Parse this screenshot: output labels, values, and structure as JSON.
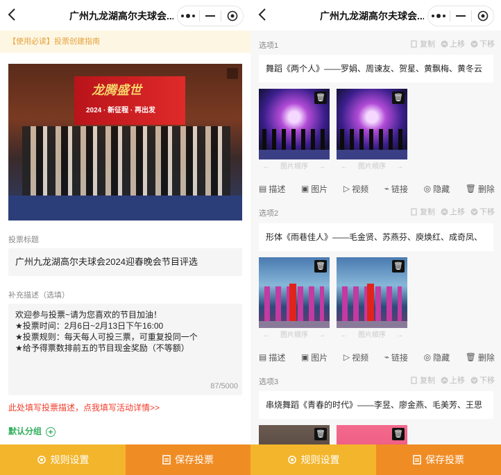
{
  "header": {
    "title": "广州九龙湖高尔夫球会...",
    "more_icon": "more-dots-icon",
    "minimize_icon": "minimize-icon",
    "close_icon": "target-close-icon"
  },
  "left": {
    "notice_tag": "【使用必读】",
    "notice_text": "投票创建指南",
    "cover_text": "龙腾盛世",
    "cover_subtext": "2024 · 新征程 · 再出发",
    "title_label": "投票标题",
    "title_value": "广州九龙湖高尔夫球会2024迎春晚会节目评选",
    "desc_label": "补充描述（选填）",
    "desc_lines": [
      "欢迎参与投票~请为您喜欢的节目加油！",
      "★投票时间：2月6日~2月13日下午16:00",
      "★投票规则：每天每人可投三票，可重复投同一个",
      "★给予得票数排前五的节目现金奖励（不等额）"
    ],
    "desc_counter": "87/5000",
    "detail_link": "此处填写投票描述，点我填写活动详情>>",
    "group_label": "默认分组"
  },
  "options": [
    {
      "label": "选项1",
      "title": "舞蹈《两个人》——罗娟、周谏友、贺星、黄飘梅、黄冬云"
    },
    {
      "label": "选项2",
      "title": "形体《雨巷佳人》——毛金贤、苏燕芬、庾焕红、成奇凤、"
    },
    {
      "label": "选项3",
      "title": "串烧舞蹈《青春的时代》——李昱、廖金燕、毛美芳、王思"
    }
  ],
  "option_controls": {
    "copy": "复制",
    "up": "上移",
    "down": "下移"
  },
  "image_order_label": "图片顺序",
  "option_actions": {
    "describe": "描述",
    "image": "图片",
    "video": "视频",
    "link": "链接",
    "hide": "隐藏",
    "delete": "删除"
  },
  "bottom_bar": {
    "rules": "规则设置",
    "save": "保存投票"
  },
  "colors": {
    "rules_bg": "#f3b52b",
    "save_bg": "#f08c24",
    "link_red": "#f23b2a",
    "group_green": "#2fae5b",
    "notice_bg": "#fdf6e3",
    "notice_text": "#e6a23c"
  }
}
